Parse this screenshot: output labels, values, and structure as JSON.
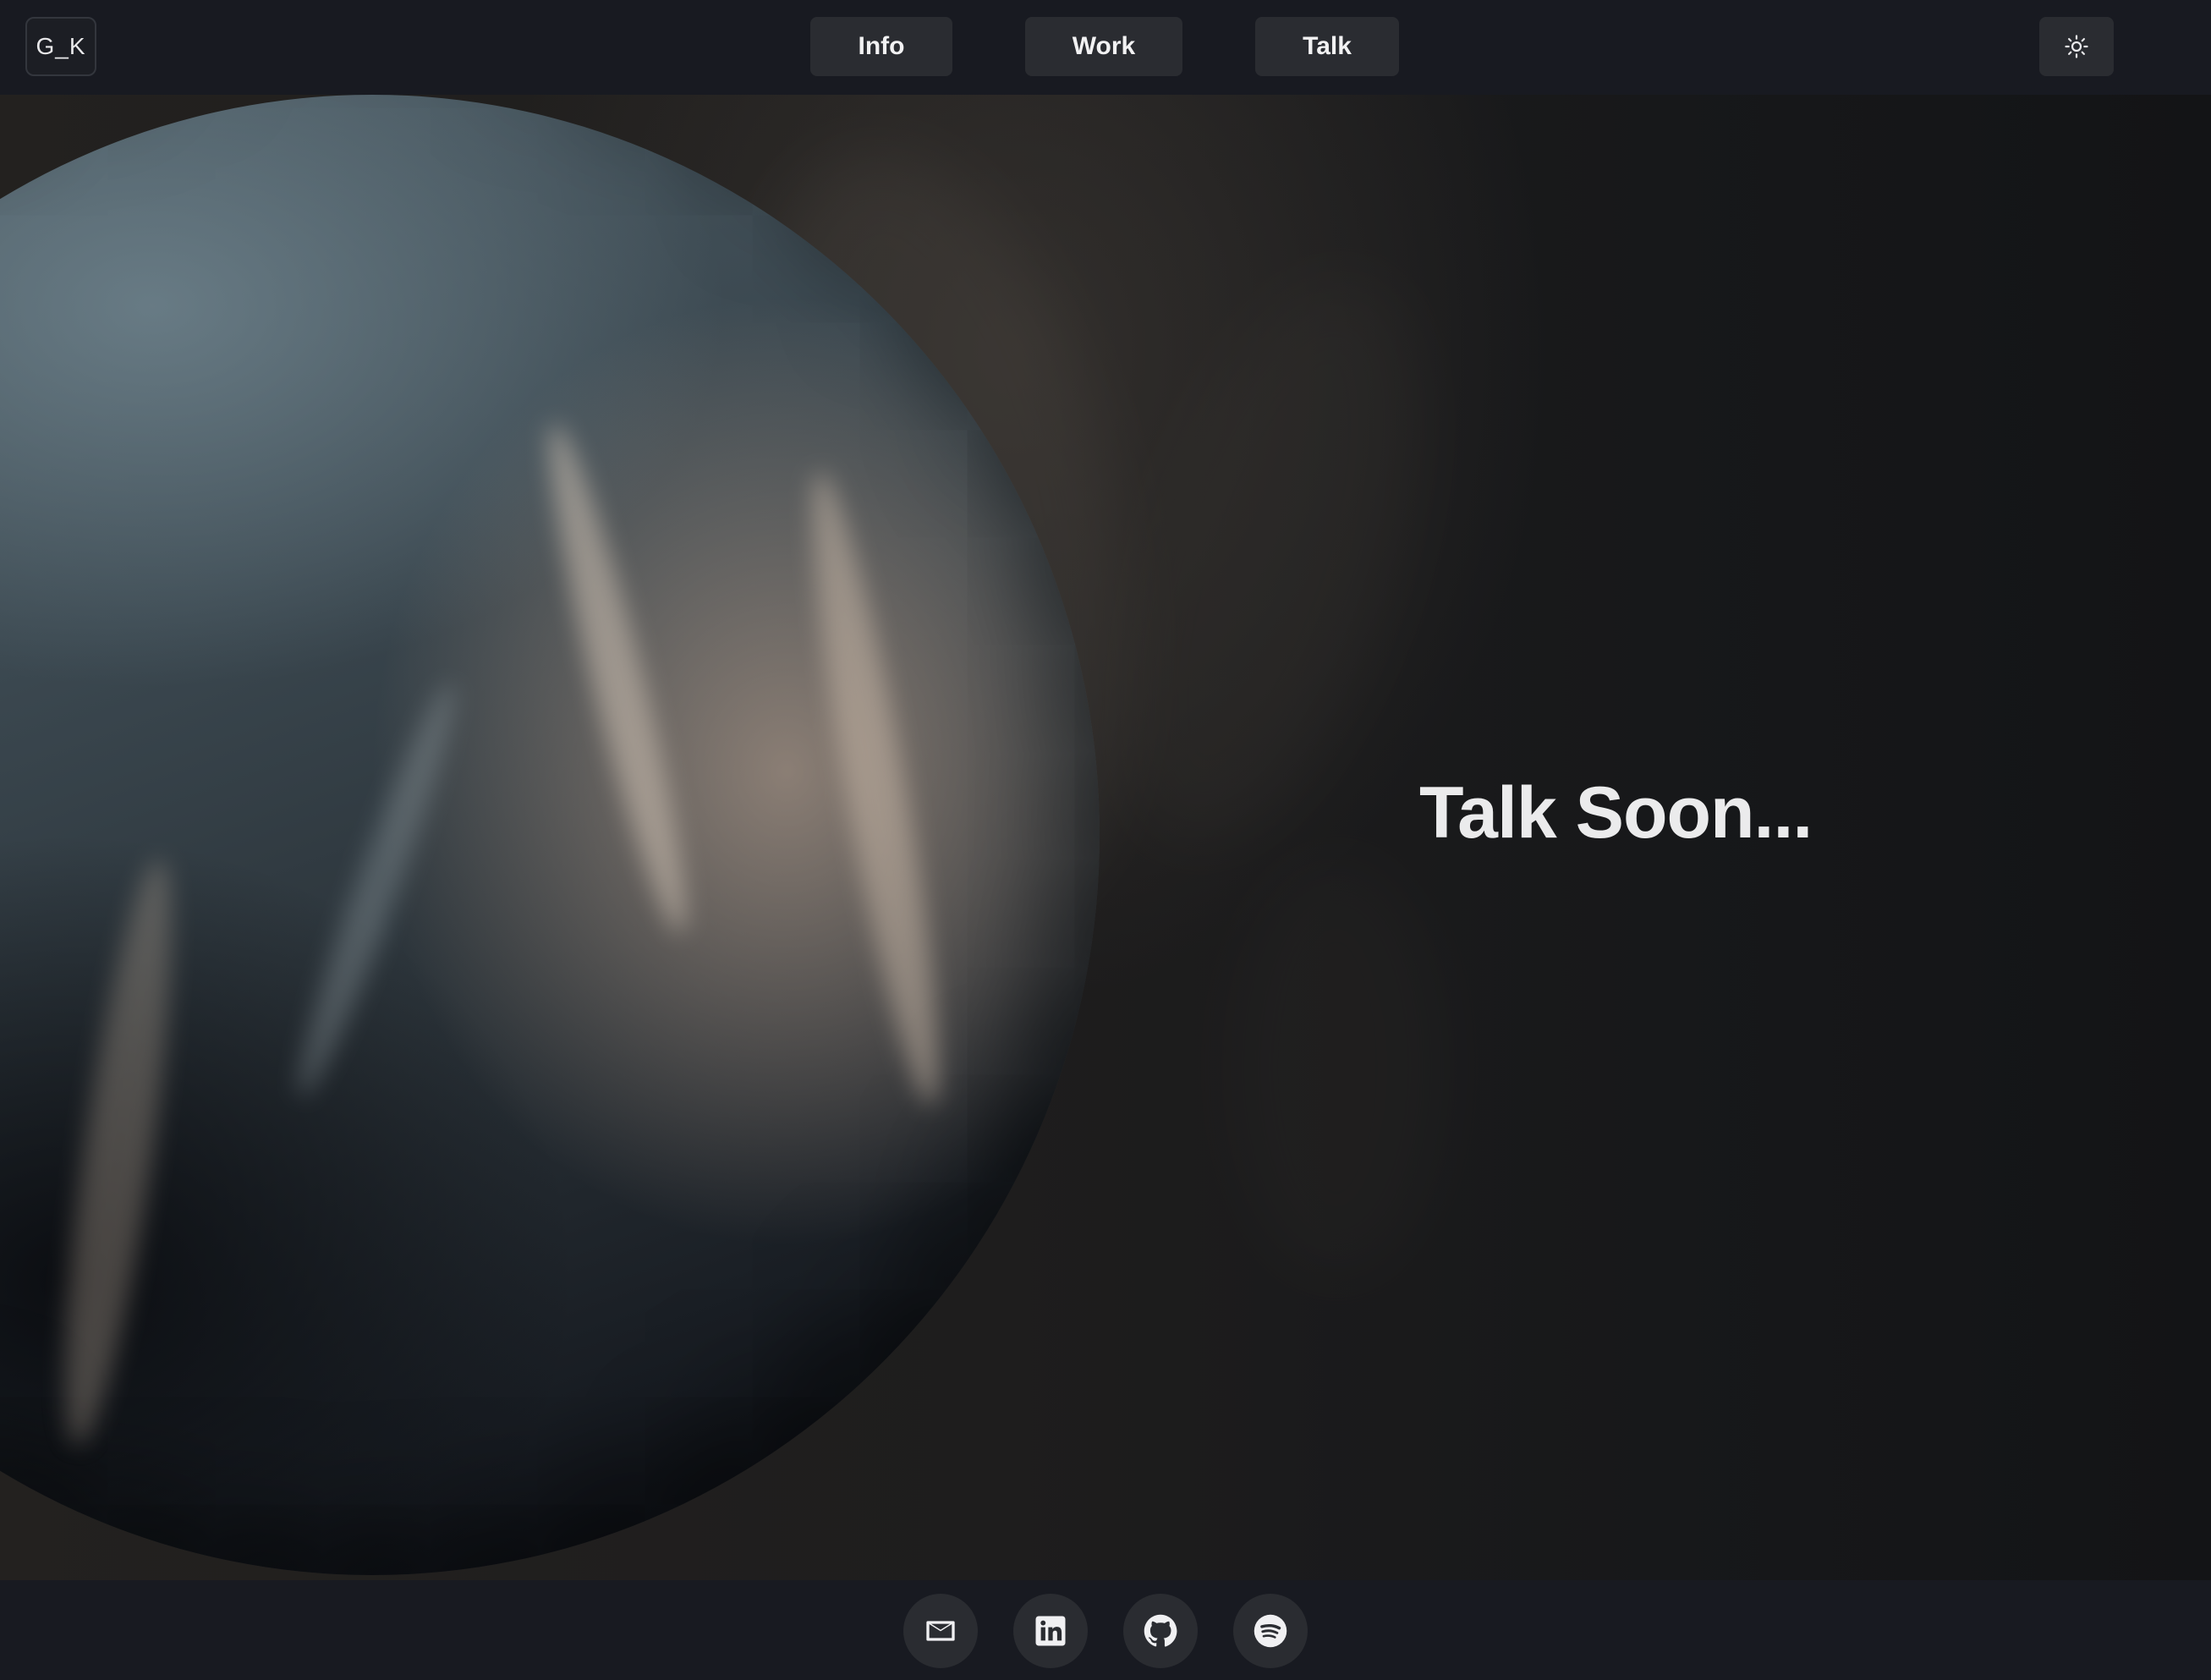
{
  "header": {
    "logo": "G_K",
    "nav": [
      {
        "label": "Info"
      },
      {
        "label": "Work"
      },
      {
        "label": "Talk"
      }
    ],
    "theme_toggle_icon": "sun-icon"
  },
  "main": {
    "title": "Talk Soon..."
  },
  "footer": {
    "links": [
      {
        "icon": "mail-icon"
      },
      {
        "icon": "linkedin-icon"
      },
      {
        "icon": "github-icon"
      },
      {
        "icon": "spotify-icon"
      }
    ]
  },
  "colors": {
    "bar_background": "#181a21",
    "button_background": "#2a2c31",
    "text": "#ebebec"
  }
}
